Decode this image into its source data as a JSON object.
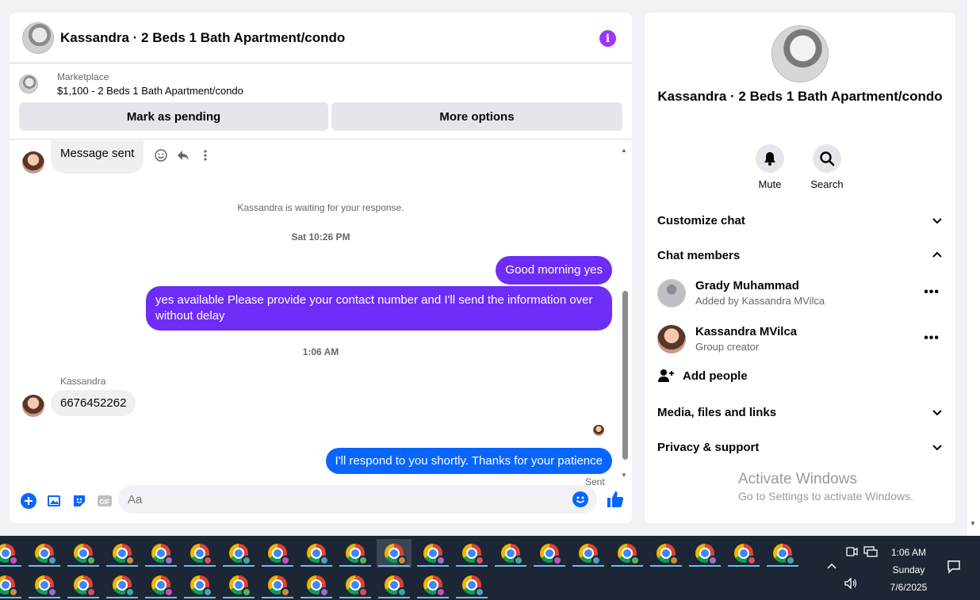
{
  "chat": {
    "title": "Kassandra · 2 Beds 1 Bath Apartment/condo",
    "marketplace_label": "Marketplace",
    "marketplace_listing": "$1,100 - 2 Beds 1 Bath Apartment/condo",
    "mark_pending": "Mark as pending",
    "more_options": "More options"
  },
  "messages": {
    "first_message": "Message sent",
    "waiting_note": "Kassandra is waiting for your response.",
    "time_1": "Sat 10:26 PM",
    "outgoing_1": "Good morning yes",
    "outgoing_2": "yes available Please provide your contact number and I'll send the information over without delay",
    "time_2": "1:06 AM",
    "sender_name": "Kassandra",
    "incoming_1": "6676452262",
    "outgoing_3": "I'll respond to you shortly. Thanks for your patience",
    "sent_status": "Sent"
  },
  "composer": {
    "placeholder": "Aa"
  },
  "info": {
    "group_name": "Kassandra · 2 Beds 1 Bath Apartment/condo",
    "mute": "Mute",
    "search": "Search",
    "customize_chat": "Customize chat",
    "chat_members": "Chat members",
    "members": [
      {
        "name": "Grady Muhammad",
        "sub": "Added by Kassandra MVilca"
      },
      {
        "name": "Kassandra MVilca",
        "sub": "Group creator"
      }
    ],
    "add_people": "Add people",
    "media": "Media, files and links",
    "privacy": "Privacy & support"
  },
  "watermark": {
    "line1": "Activate Windows",
    "line2": "Go to Settings to activate Windows."
  },
  "taskbar": {
    "time": "1:06 AM",
    "day": "Sunday",
    "date": "7/6/2025"
  },
  "colors": {
    "accent_purple": "#6e2cf7",
    "accent_blue": "#0866ff",
    "info_icon": "#a033ff"
  }
}
